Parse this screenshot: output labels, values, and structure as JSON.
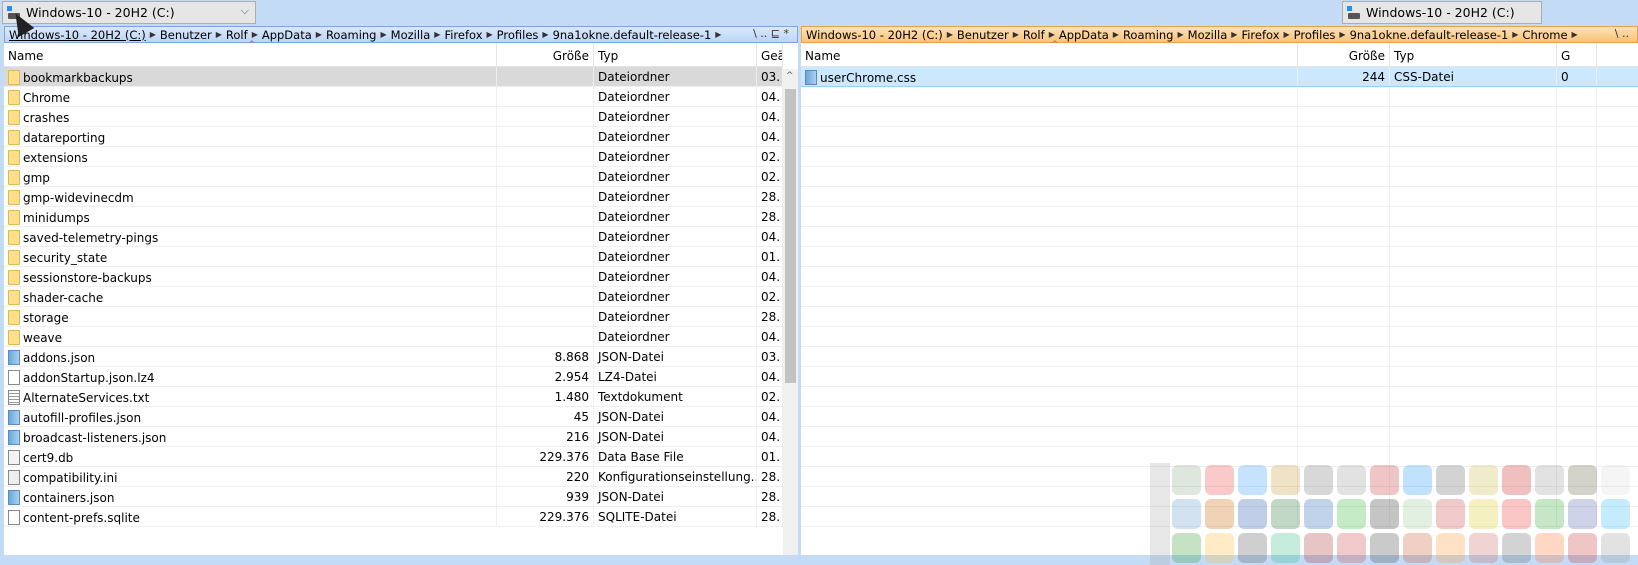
{
  "left": {
    "drive": "Windows-10 - 20H2 (C:)",
    "breadcrumb": [
      "Windows-10 - 20H2 (C:)",
      "Benutzer",
      "Rolf",
      "AppData",
      "Roaming",
      "Mozilla",
      "Firefox",
      "Profiles",
      "9na1okne.default-release-1"
    ],
    "tools": "\\ .. ⊑ *",
    "columns": {
      "name": "Name",
      "size": "Größe",
      "type": "Typ",
      "date": "Geä"
    },
    "rows": [
      {
        "icon": "folder",
        "name": "bookmarkbackups",
        "size": "",
        "type": "Dateiordner",
        "date": "03."
      },
      {
        "icon": "folder",
        "name": "Chrome",
        "size": "",
        "type": "Dateiordner",
        "date": "04."
      },
      {
        "icon": "folder",
        "name": "crashes",
        "size": "",
        "type": "Dateiordner",
        "date": "04."
      },
      {
        "icon": "folder",
        "name": "datareporting",
        "size": "",
        "type": "Dateiordner",
        "date": "04."
      },
      {
        "icon": "folder",
        "name": "extensions",
        "size": "",
        "type": "Dateiordner",
        "date": "02."
      },
      {
        "icon": "folder",
        "name": "gmp",
        "size": "",
        "type": "Dateiordner",
        "date": "02."
      },
      {
        "icon": "folder",
        "name": "gmp-widevinecdm",
        "size": "",
        "type": "Dateiordner",
        "date": "28."
      },
      {
        "icon": "folder",
        "name": "minidumps",
        "size": "",
        "type": "Dateiordner",
        "date": "28."
      },
      {
        "icon": "folder",
        "name": "saved-telemetry-pings",
        "size": "",
        "type": "Dateiordner",
        "date": "04."
      },
      {
        "icon": "folder",
        "name": "security_state",
        "size": "",
        "type": "Dateiordner",
        "date": "01."
      },
      {
        "icon": "folder",
        "name": "sessionstore-backups",
        "size": "",
        "type": "Dateiordner",
        "date": "04."
      },
      {
        "icon": "folder",
        "name": "shader-cache",
        "size": "",
        "type": "Dateiordner",
        "date": "02."
      },
      {
        "icon": "folder",
        "name": "storage",
        "size": "",
        "type": "Dateiordner",
        "date": "28."
      },
      {
        "icon": "folder",
        "name": "weave",
        "size": "",
        "type": "Dateiordner",
        "date": "04."
      },
      {
        "icon": "json",
        "name": "addons.json",
        "size": "8.868",
        "type": "JSON-Datei",
        "date": "03."
      },
      {
        "icon": "file",
        "name": "addonStartup.json.lz4",
        "size": "2.954",
        "type": "LZ4-Datei",
        "date": "04."
      },
      {
        "icon": "text",
        "name": "AlternateServices.txt",
        "size": "1.480",
        "type": "Textdokument",
        "date": "02."
      },
      {
        "icon": "json",
        "name": "autofill-profiles.json",
        "size": "45",
        "type": "JSON-Datei",
        "date": "04."
      },
      {
        "icon": "json",
        "name": "broadcast-listeners.json",
        "size": "216",
        "type": "JSON-Datei",
        "date": "04."
      },
      {
        "icon": "db",
        "name": "cert9.db",
        "size": "229.376",
        "type": "Data Base File",
        "date": "01."
      },
      {
        "icon": "ini",
        "name": "compatibility.ini",
        "size": "220",
        "type": "Konfigurationseinstellung...",
        "date": "28."
      },
      {
        "icon": "json",
        "name": "containers.json",
        "size": "939",
        "type": "JSON-Datei",
        "date": "28."
      },
      {
        "icon": "file",
        "name": "content-prefs.sqlite",
        "size": "229.376",
        "type": "SQLITE-Datei",
        "date": "28."
      }
    ]
  },
  "right": {
    "drive": "Windows-10 - 20H2 (C:)",
    "breadcrumb": [
      "Windows-10 - 20H2 (C:)",
      "Benutzer",
      "Rolf",
      "AppData",
      "Roaming",
      "Mozilla",
      "Firefox",
      "Profiles",
      "9na1okne.default-release-1",
      "Chrome"
    ],
    "tools": "\\ ..",
    "columns": {
      "name": "Name",
      "size": "Größe",
      "type": "Typ",
      "date": "G"
    },
    "rows": [
      {
        "icon": "json",
        "name": "userChrome.css",
        "size": "244",
        "type": "CSS-Datei",
        "date": "0"
      }
    ]
  },
  "dock_colors": [
    "#8a8",
    "#e44",
    "#39f",
    "#c93",
    "#777",
    "#999",
    "#c33",
    "#29f",
    "#666",
    "#cb4",
    "#c22",
    "#999",
    "#664",
    "#ddd",
    "#69c",
    "#c60",
    "#25a",
    "#273",
    "#26b",
    "#3b3",
    "#333",
    "#9c9",
    "#c44",
    "#dc2",
    "#e33",
    "#3a3",
    "#56a",
    "#3bf",
    "#393",
    "#fb3",
    "#555",
    "#3b8",
    "#a33",
    "#c44",
    "#444",
    "#c53",
    "#f93",
    "#c66",
    "#666",
    "#f73",
    "#c33",
    "#999"
  ]
}
